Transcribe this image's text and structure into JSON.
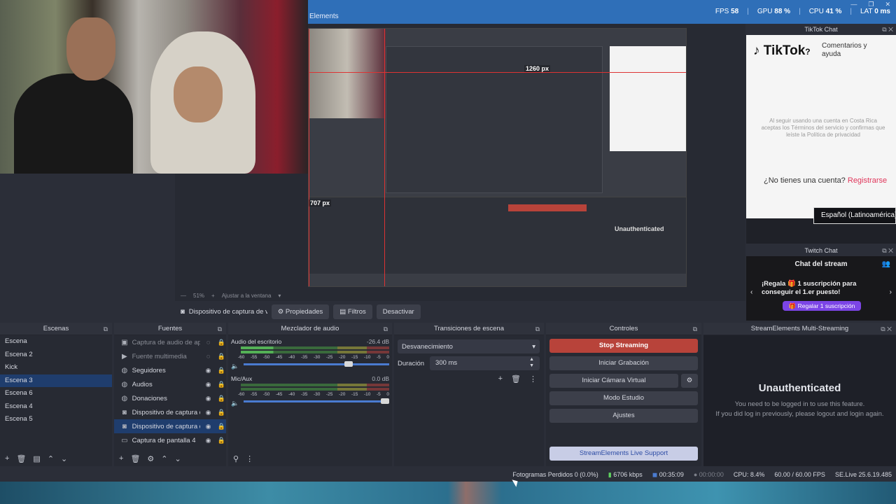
{
  "window": {
    "title": "Elements",
    "stats": {
      "fps_label": "FPS",
      "fps_value": "58",
      "gpu_label": "GPU",
      "gpu_value": "88 %",
      "cpu_label": "CPU",
      "cpu_value": "41 %",
      "lat_label": "LAT",
      "lat_value": "0 ms"
    }
  },
  "preview": {
    "overlay_width_label": "1260 px",
    "overlay_height_label": "707 px",
    "zoom": "51%",
    "fit_label": "Ajustar a la ventana",
    "nested_unauth": "Unauthenticated"
  },
  "source_toolbar": {
    "source_name": "Dispositivo de captura de v",
    "properties": "Propiedades",
    "filters": "Filtros",
    "deactivate": "Desactivar"
  },
  "scenes": {
    "title": "Escenas",
    "items": [
      "Escena",
      "Escena 2",
      "Kick",
      "Escena 3",
      "Escena 6",
      "Escena 4",
      "Escena 5"
    ],
    "selected": "Escena 3"
  },
  "sources": {
    "title": "Fuentes",
    "items": [
      {
        "name": "Captura de audio de aplic",
        "icon": "audio-capture-icon",
        "hidden": true
      },
      {
        "name": "Fuente multimedia",
        "icon": "play-icon",
        "hidden": true
      },
      {
        "name": "Seguidores",
        "icon": "browser-icon",
        "hidden": false
      },
      {
        "name": "Audios",
        "icon": "browser-icon",
        "hidden": false
      },
      {
        "name": "Donaciones",
        "icon": "browser-icon",
        "hidden": false
      },
      {
        "name": "Dispositivo de captura de",
        "icon": "camera-icon",
        "hidden": false
      },
      {
        "name": "Dispositivo de captura de",
        "icon": "camera-icon",
        "hidden": false
      },
      {
        "name": "Captura de pantalla 4",
        "icon": "monitor-icon",
        "hidden": false
      }
    ]
  },
  "mixer": {
    "title": "Mezclador de audio",
    "channels": [
      {
        "name": "Audio del escritorio",
        "db": "-26.4 dB",
        "level": 0.22,
        "volume": 0.75
      },
      {
        "name": "Mic/Aux",
        "db": "0.0 dB",
        "level": 0.0,
        "volume": 1.0
      }
    ],
    "ticks": [
      "-60",
      "-55",
      "-50",
      "-45",
      "-40",
      "-35",
      "-30",
      "-25",
      "-20",
      "-15",
      "-10",
      "-5",
      "0"
    ]
  },
  "transitions": {
    "title": "Transiciones de escena",
    "selected": "Desvanecimiento",
    "duration_label": "Duración",
    "duration_value": "300 ms"
  },
  "controls": {
    "title": "Controles",
    "stop_streaming": "Stop Streaming",
    "start_recording": "Iniciar Grabación",
    "start_virtual_cam": "Iniciar Cámara Virtual",
    "studio_mode": "Modo Estudio",
    "settings": "Ajustes",
    "se_support": "StreamElements Live Support"
  },
  "se_multistream": {
    "title": "StreamElements Multi-Streaming",
    "heading": "Unauthenticated",
    "line1": "You need to be logged in to use this feature.",
    "line2": "If you did log in previously, please logout and login again."
  },
  "tiktok": {
    "title": "TikTok Chat",
    "logo": "TikTok",
    "subtitle": "Comentarios y ayuda",
    "terms": "Al seguir usando una cuenta en Costa Rica aceptas los Términos del servicio y confirmas que leíste la Política de privacidad",
    "question": "¿No tienes una cuenta?",
    "register": "Registrarse",
    "language": "Español (Latinoamérica)"
  },
  "twitch": {
    "title": "Twitch Chat",
    "chat_header": "Chat del stream",
    "promo": "¡Regala 🎁 1 suscripción para conseguir el 1.er puesto!",
    "gift_button": "Regalar 1 suscripción"
  },
  "status": {
    "dropped_frames": "Fotogramas Perdidos 0 (0.0%)",
    "bitrate": "6706 kbps",
    "stream_time": "00:35:09",
    "rec_time": "00:00:00",
    "cpu": "CPU: 8.4%",
    "fps": "60.00 / 60.00 FPS",
    "version": "SE.Live 25.6.19.485"
  },
  "colors": {
    "accent": "#2f6fb8",
    "stop": "#b8433a",
    "selection": "#1f3d6d",
    "twitch_purple": "#7c45e6",
    "tiktok_pink": "#e0355a"
  }
}
